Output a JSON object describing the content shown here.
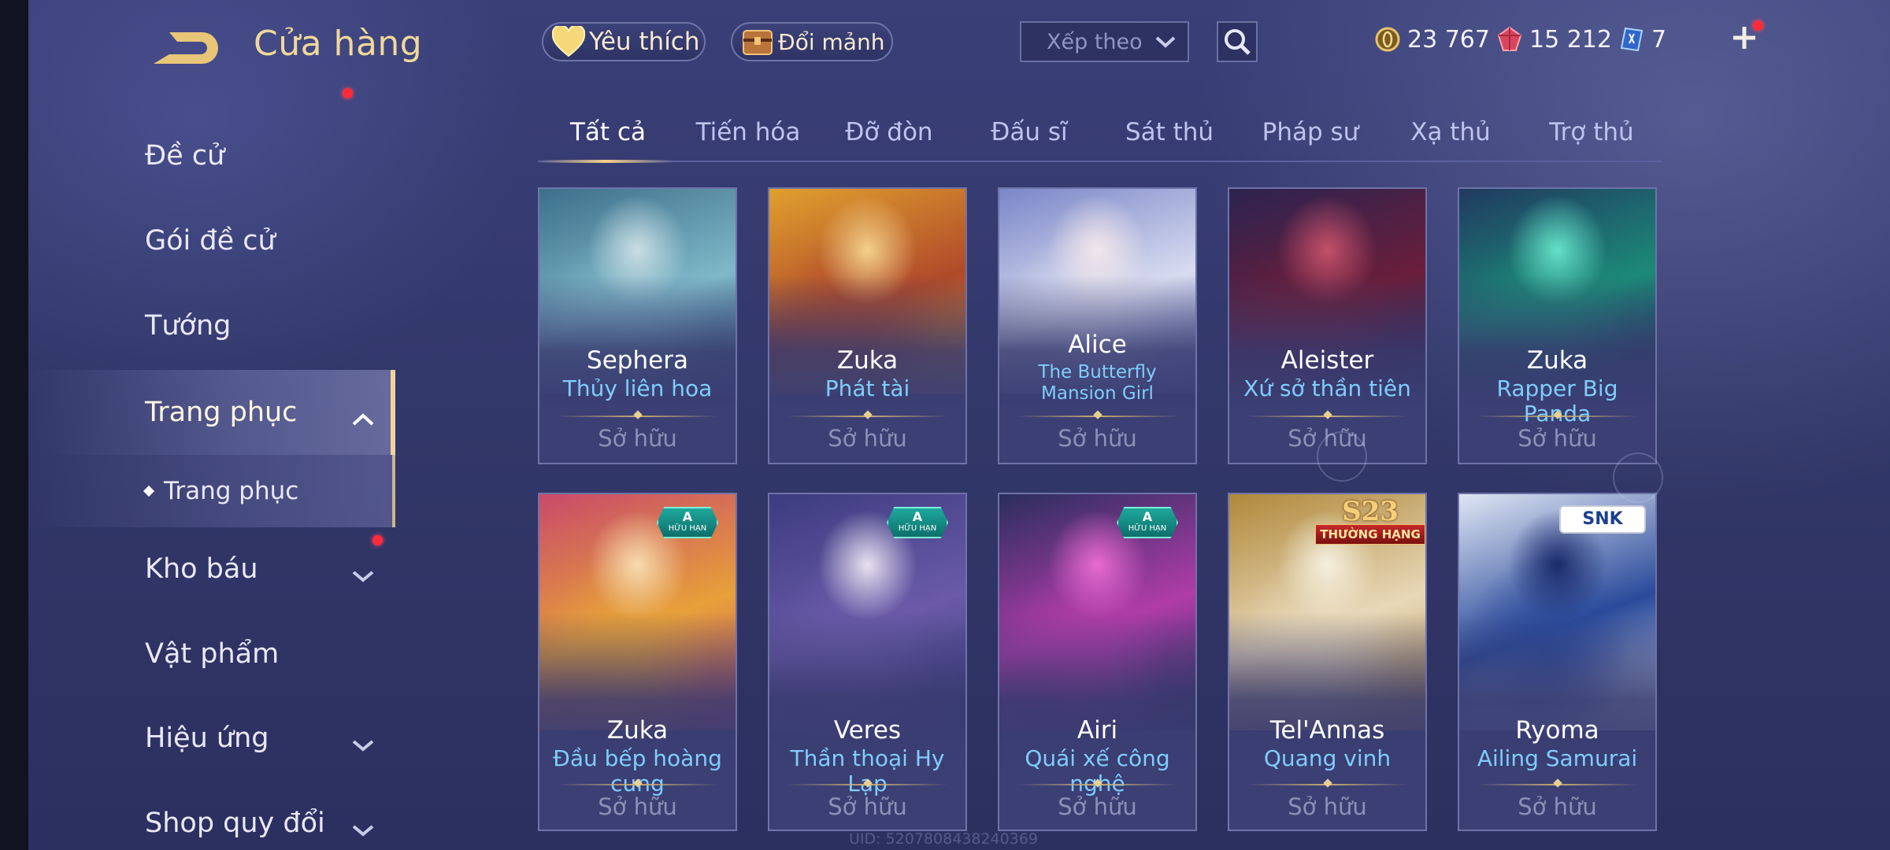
{
  "header": {
    "title": "Cửa hàng",
    "favorites_label": "Yêu thích",
    "exchange_label": "Đổi mảnh",
    "sort_placeholder": "Xếp theo",
    "currencies": [
      {
        "name": "gold",
        "value": "23 767",
        "color": "#e8c36a"
      },
      {
        "name": "voucher",
        "value": "15 212",
        "color": "#e0506a"
      },
      {
        "name": "crystal",
        "value": "7",
        "color": "#6fb8ff"
      }
    ]
  },
  "sidebar": {
    "items": [
      {
        "label": "Đề cử"
      },
      {
        "label": "Gói đề cử"
      },
      {
        "label": "Tướng"
      },
      {
        "label": "Trang phục"
      },
      {
        "label": "Trang phục"
      },
      {
        "label": "Kho báu"
      },
      {
        "label": "Vật phẩm"
      },
      {
        "label": "Hiệu ứng"
      },
      {
        "label": "Shop quy đổi"
      }
    ]
  },
  "tabs": [
    "Tất cả",
    "Tiến hóa",
    "Đỡ đòn",
    "Đấu sĩ",
    "Sát thủ",
    "Pháp sư",
    "Xạ thủ",
    "Trợ thủ"
  ],
  "cards": [
    {
      "hero": "Sephera",
      "skin": "Thủy liên hoa",
      "status": "Sở hữu",
      "palette": [
        "#7fb8c9",
        "#3d6f8a",
        "#c9dde4"
      ]
    },
    {
      "hero": "Zuka",
      "skin": "Phát tài",
      "status": "Sở hữu",
      "palette": [
        "#b04a2a",
        "#e0a02e",
        "#f3d08a"
      ]
    },
    {
      "hero": "Alice",
      "skin": "The Butterfly Mansion Girl",
      "status": "Sở hữu",
      "palette": [
        "#d8dcf0",
        "#7a86c8",
        "#f2e6ea"
      ]
    },
    {
      "hero": "Aleister",
      "skin": "Xứ sở thần tiên",
      "status": "Sở hữu",
      "palette": [
        "#6a1e3a",
        "#2c2350",
        "#c2506a"
      ]
    },
    {
      "hero": "Zuka",
      "skin": "Rapper Big Panda",
      "status": "Sở hữu",
      "palette": [
        "#1c8a78",
        "#203a60",
        "#64e0c8"
      ]
    },
    {
      "hero": "Zuka",
      "skin": "Đầu bếp hoàng cung",
      "status": "Sở hữu",
      "badge": {
        "type": "A",
        "line1": "A",
        "line2": "HỮU HẠN"
      },
      "palette": [
        "#e7a03a",
        "#c84a6a",
        "#f7dcb0"
      ]
    },
    {
      "hero": "Veres",
      "skin": "Thần thoại Hy Lạp",
      "status": "Sở hữu",
      "badge": {
        "type": "A",
        "line1": "A",
        "line2": "HỮU HẠN"
      },
      "palette": [
        "#6a5aa8",
        "#3c3c80",
        "#e8e2f0"
      ]
    },
    {
      "hero": "Airi",
      "skin": "Quái xế công nghệ",
      "status": "Sở hữu",
      "badge": {
        "type": "A",
        "line1": "A",
        "line2": "HỮU HẠN"
      },
      "palette": [
        "#b03ca8",
        "#2a2e5e",
        "#e86ad0"
      ]
    },
    {
      "hero": "Tel'Annas",
      "skin": "Quang vinh",
      "status": "Sở hữu",
      "badge": {
        "type": "S23",
        "line1": "S23",
        "line2": "THƯỜNG HẠNG"
      },
      "palette": [
        "#e8d8b8",
        "#b0883a",
        "#f6f0e0"
      ]
    },
    {
      "hero": "Ryoma",
      "skin": "Ailing Samurai",
      "status": "Sở hữu",
      "badge": {
        "type": "SNK",
        "line1": "SNK"
      },
      "palette": [
        "#2a4a9a",
        "#dfe6f4",
        "#1a2a6a"
      ]
    }
  ],
  "footer": {
    "uid": "UID: 5207808438240369"
  }
}
